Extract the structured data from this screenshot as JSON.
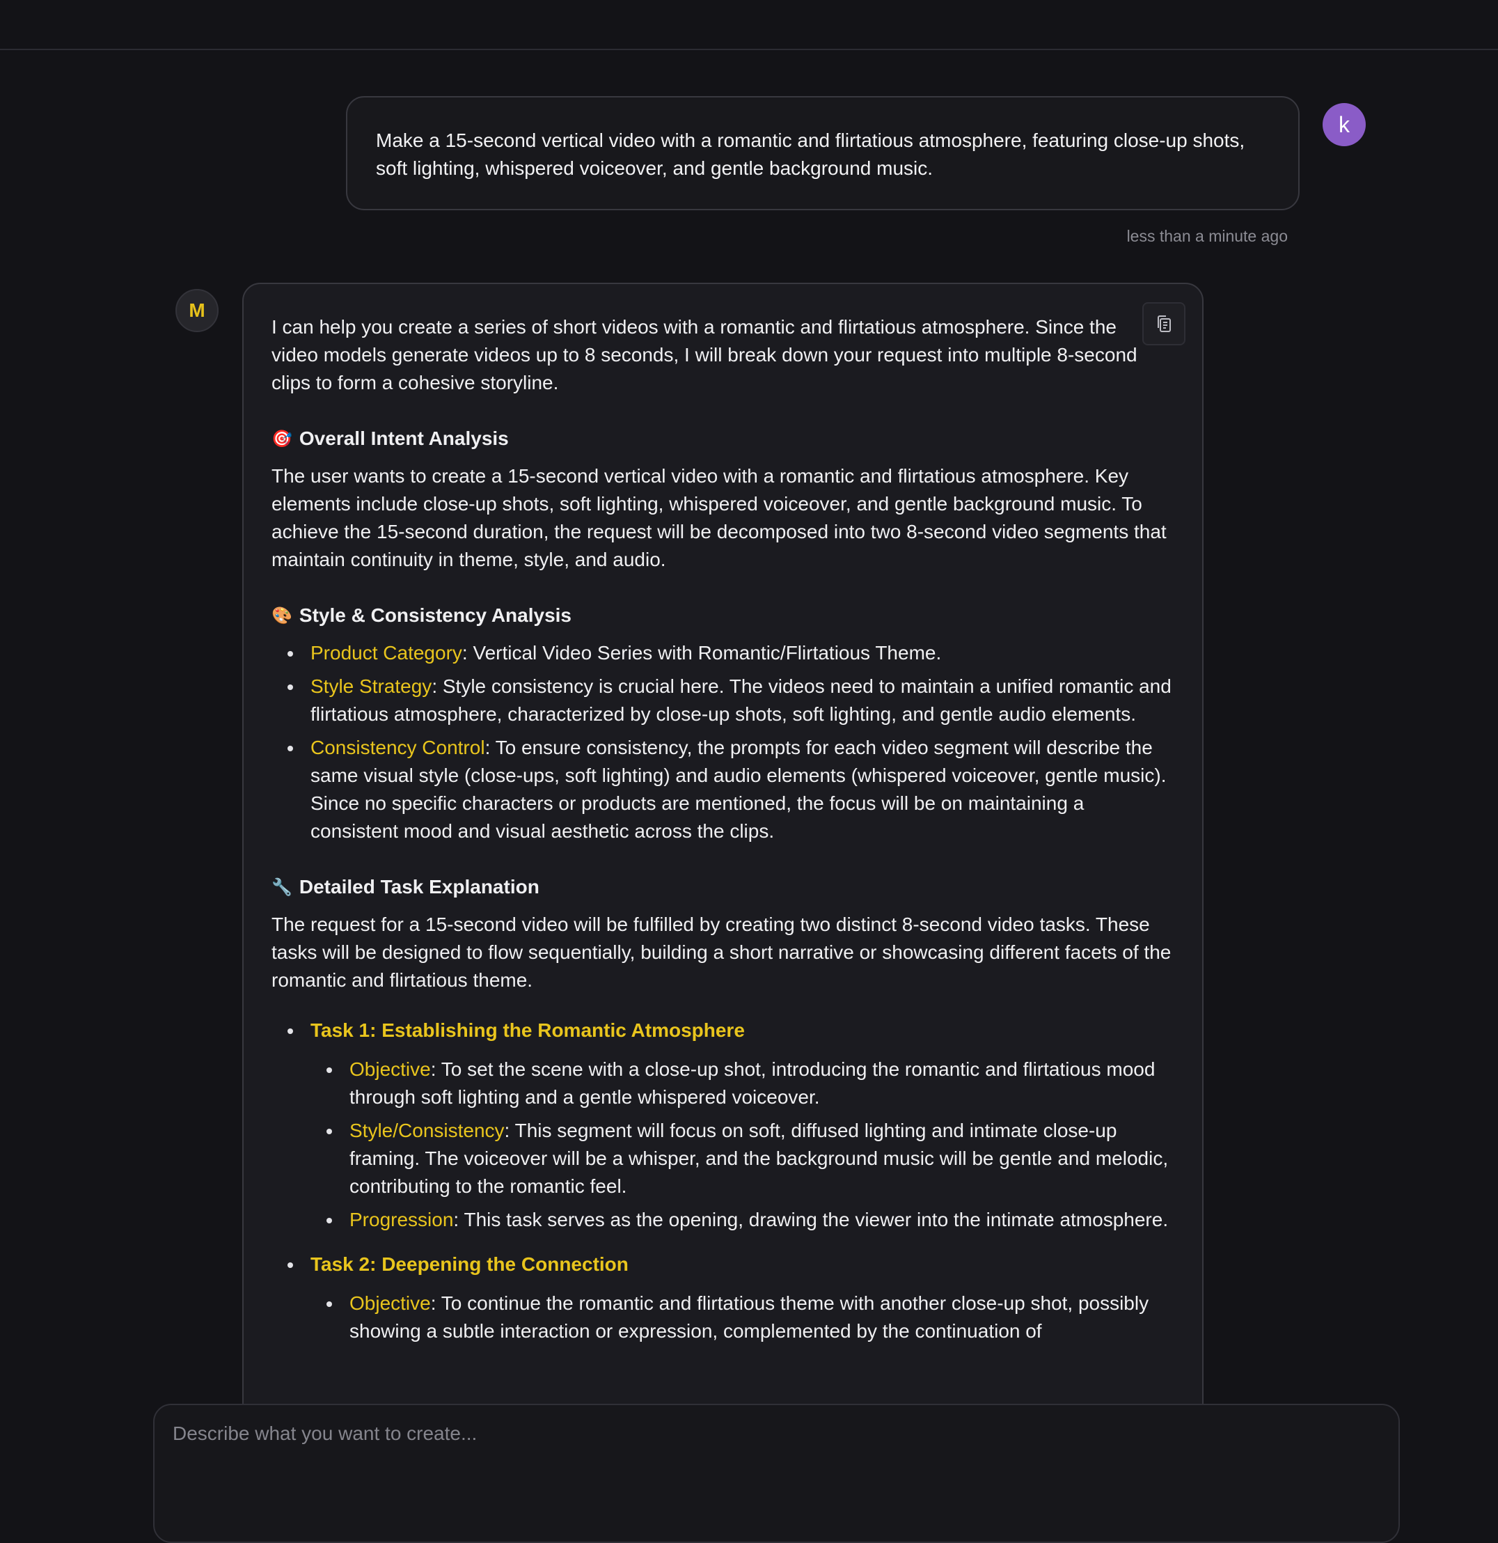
{
  "user_message": {
    "text": "Make a 15-second vertical video with a romantic and flirtatious atmosphere, featuring close-up shots, soft lighting, whispered voiceover, and gentle background music.",
    "avatar_letter": "k",
    "timestamp": "less than a minute ago"
  },
  "assistant_message": {
    "avatar_letter": "M",
    "intro": "I can help you create a series of short videos with a romantic and flirtatious atmosphere. Since the video models generate videos up to 8 seconds, I will break down your request into multiple 8-second clips to form a cohesive storyline.",
    "sections": [
      {
        "emoji": "🎯",
        "heading": "Overall Intent Analysis",
        "body": "The user wants to create a 15-second vertical video with a romantic and flirtatious atmosphere. Key elements include close-up shots, soft lighting, whispered voiceover, and gentle background music. To achieve the 15-second duration, the request will be decomposed into two 8-second video segments that maintain continuity in theme, style, and audio."
      },
      {
        "emoji": "🎨",
        "heading": "Style & Consistency Analysis",
        "items": [
          {
            "label": "Product Category",
            "text": ": Vertical Video Series with Romantic/Flirtatious Theme."
          },
          {
            "label": "Style Strategy",
            "text": ": Style consistency is crucial here. The videos need to maintain a unified romantic and flirtatious atmosphere, characterized by close-up shots, soft lighting, and gentle audio elements."
          },
          {
            "label": "Consistency Control",
            "text": ": To ensure consistency, the prompts for each video segment will describe the same visual style (close-ups, soft lighting) and audio elements (whispered voiceover, gentle music). Since no specific characters or products are mentioned, the focus will be on maintaining a consistent mood and visual aesthetic across the clips."
          }
        ]
      },
      {
        "emoji": "🔧",
        "heading": "Detailed Task Explanation",
        "body": "The request for a 15-second video will be fulfilled by creating two distinct 8-second video tasks. These tasks will be designed to flow sequentially, building a short narrative or showcasing different facets of the romantic and flirtatious theme."
      }
    ],
    "tasks": [
      {
        "title": "Task 1: Establishing the Romantic Atmosphere",
        "items": [
          {
            "label": "Objective",
            "text": ": To set the scene with a close-up shot, introducing the romantic and flirtatious mood through soft lighting and a gentle whispered voiceover."
          },
          {
            "label": "Style/Consistency",
            "text": ": This segment will focus on soft, diffused lighting and intimate close-up framing. The voiceover will be a whisper, and the background music will be gentle and melodic, contributing to the romantic feel."
          },
          {
            "label": "Progression",
            "text": ": This task serves as the opening, drawing the viewer into the intimate atmosphere."
          }
        ]
      },
      {
        "title": "Task 2: Deepening the Connection",
        "items": [
          {
            "label": "Objective",
            "text": ": To continue the romantic and flirtatious theme with another close-up shot, possibly showing a subtle interaction or expression, complemented by the continuation of"
          }
        ]
      }
    ]
  },
  "composer": {
    "placeholder": "Describe what you want to create..."
  },
  "colors": {
    "background": "#131317",
    "accent": "#e9c51d",
    "user_avatar": "#8a5cc7"
  },
  "icons": {
    "copy": "copy-icon"
  }
}
